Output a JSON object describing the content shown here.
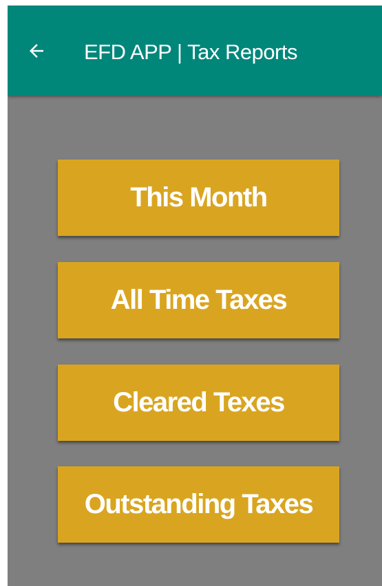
{
  "app_bar": {
    "title": "EFD APP | Tax Reports",
    "back_icon": "arrow-left-icon",
    "background_color": "#00877a"
  },
  "menu": {
    "button_color": "#d9a521",
    "items": [
      {
        "label": "This Month"
      },
      {
        "label": "All Time Taxes"
      },
      {
        "label": "Cleared Texes"
      },
      {
        "label": "Outstanding Taxes"
      }
    ]
  },
  "screen_background": "#7f7f7f"
}
